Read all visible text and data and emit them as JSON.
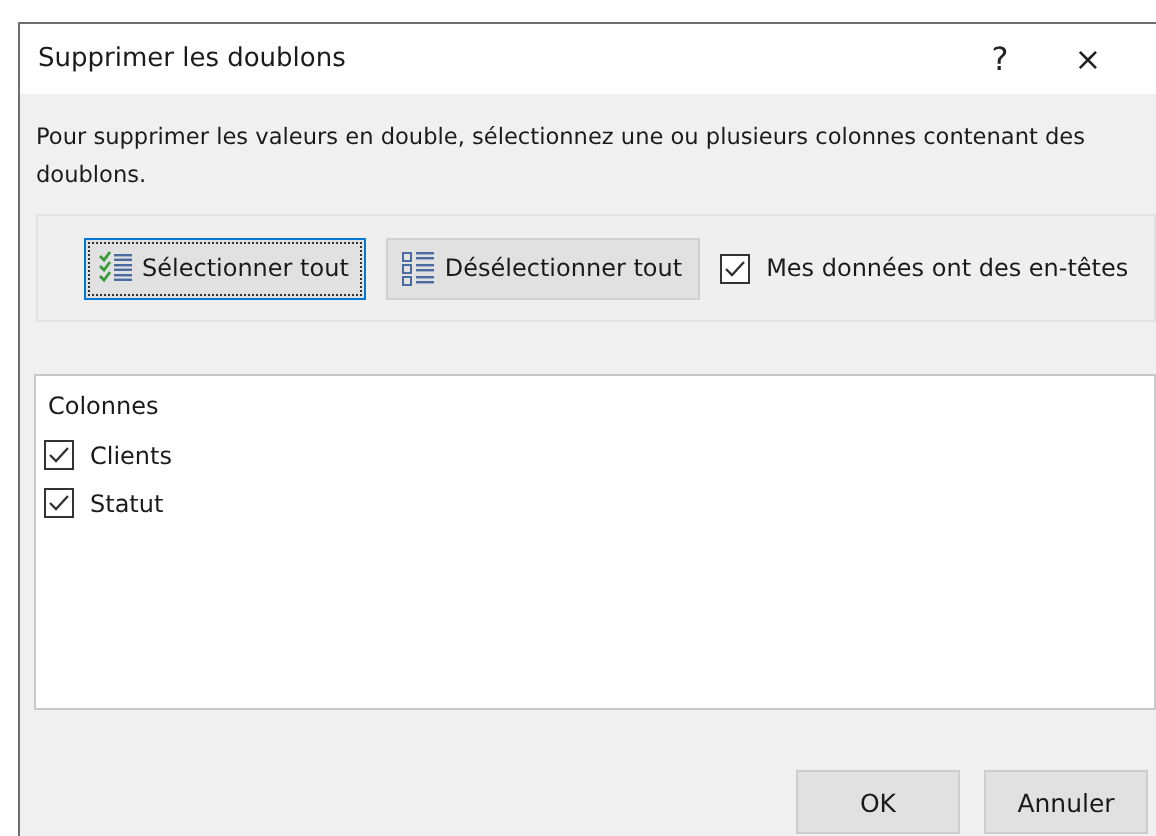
{
  "window": {
    "title": "Supprimer les doublons",
    "help": "?",
    "close": "×"
  },
  "description": "Pour supprimer les valeurs en double, sélectionnez une ou plusieurs colonnes contenant des doublons.",
  "toolbar": {
    "select_all": {
      "label": "Sélectionner tout",
      "focused": true
    },
    "deselect_all": {
      "label": "Désélectionner tout",
      "focused": false
    },
    "headers": {
      "label": "Mes données ont des en-têtes",
      "checked": true
    }
  },
  "columns": {
    "heading": "Colonnes",
    "items": [
      {
        "label": "Clients",
        "checked": true
      },
      {
        "label": "Statut",
        "checked": true
      }
    ]
  },
  "buttons": [
    "OK",
    "Annuler"
  ]
}
